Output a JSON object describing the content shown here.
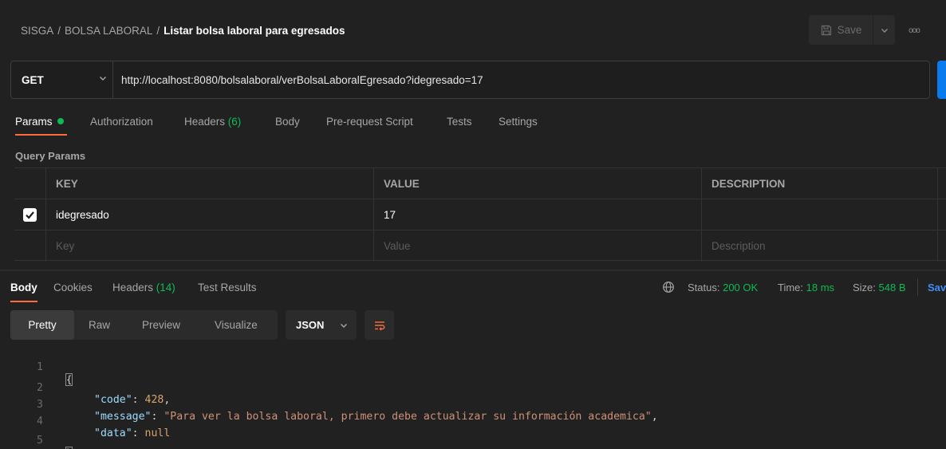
{
  "header": {
    "breadcrumb": [
      "SISGA",
      "BOLSA LABORAL",
      "Listar bolsa laboral para egresados"
    ],
    "separator": "/",
    "save_label": "Save",
    "save_icon": "save-icon",
    "more_icon": "ooo"
  },
  "request": {
    "method": "GET",
    "url": "http://localhost:8080/bolsalaboral/verBolsaLaboralEgresado?idegresado=17"
  },
  "request_tabs": {
    "params": "Params",
    "authorization": "Authorization",
    "headers": "Headers",
    "headers_count": "(6)",
    "body": "Body",
    "pre_request": "Pre-request Script",
    "tests": "Tests",
    "settings": "Settings"
  },
  "query_params": {
    "title": "Query Params",
    "columns": {
      "key": "KEY",
      "value": "VALUE",
      "description": "DESCRIPTION"
    },
    "rows": [
      {
        "checked": true,
        "key": "idegresado",
        "value": "17",
        "description": ""
      }
    ],
    "placeholders": {
      "key": "Key",
      "value": "Value",
      "description": "Description"
    }
  },
  "response": {
    "tabs": {
      "body": "Body",
      "cookies": "Cookies",
      "headers": "Headers",
      "headers_count": "(14)",
      "test_results": "Test Results"
    },
    "status_label": "Status:",
    "status_value": "200 OK",
    "time_label": "Time:",
    "time_value": "18 ms",
    "size_label": "Size:",
    "size_value": "548 B",
    "save_label": "Sav",
    "view_modes": {
      "pretty": "Pretty",
      "raw": "Raw",
      "preview": "Preview",
      "visualize": "Visualize"
    },
    "format": "JSON",
    "lines": [
      "1",
      "2",
      "3",
      "4",
      "5"
    ],
    "code": {
      "code_key": "\"code\"",
      "code_value": "428",
      "message_key": "\"message\"",
      "message_value": "\"Para ver la bolsa laboral, primero debe actualizar su información academica\"",
      "data_key": "\"data\"",
      "data_value": "null"
    }
  },
  "colors": {
    "accent": "#ff6c37",
    "success": "#0cbb52",
    "send": "#097bed"
  }
}
